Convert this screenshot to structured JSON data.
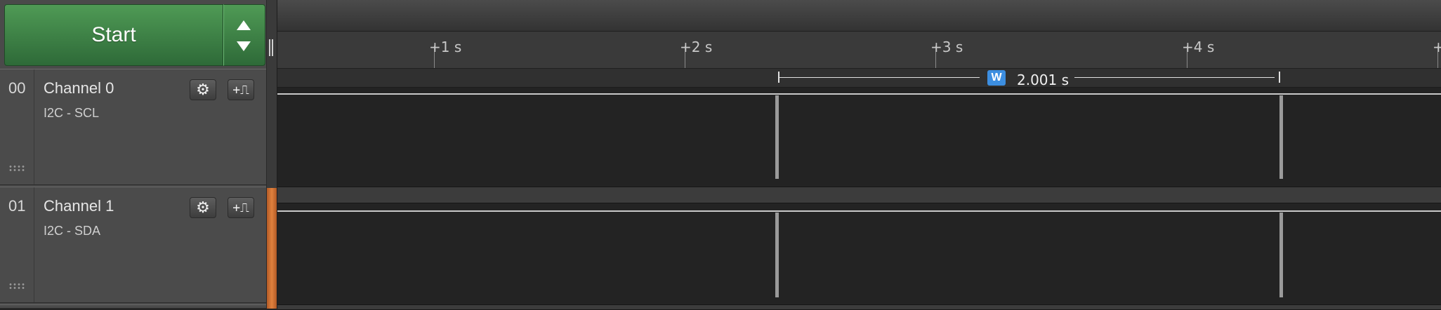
{
  "capture": {
    "start_label": "Start",
    "up_icon": "triangle-up-icon",
    "down_icon": "triangle-down-icon"
  },
  "timeline": {
    "ticks": [
      "+1 s",
      "+2 s",
      "+3 s",
      "+4 s",
      "+"
    ],
    "measurement": {
      "badge": "W",
      "value": "2.001 s"
    }
  },
  "channels": [
    {
      "index": "00",
      "name": "Channel 0",
      "protocol": "I2C - SCL",
      "settings_icon": "gear-icon",
      "trigger_icon": "trigger-rising-icon",
      "trigger_glyph": "+⎍"
    },
    {
      "index": "01",
      "name": "Channel 1",
      "protocol": "I2C - SDA",
      "settings_icon": "gear-icon",
      "trigger_icon": "trigger-rising-icon",
      "trigger_glyph": "+⎍"
    }
  ],
  "colors": {
    "start_green": "#3f8a49",
    "measurement_blue": "#3c8ee0",
    "channel_marker_orange": "#e0813d"
  }
}
